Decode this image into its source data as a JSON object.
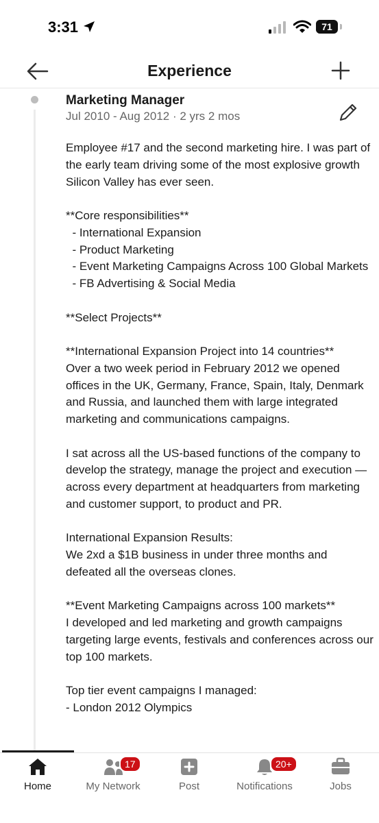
{
  "status_bar": {
    "time": "3:31",
    "battery": "71",
    "battery_level": 0.71
  },
  "header": {
    "title": "Experience"
  },
  "experience": {
    "title": "Marketing Manager",
    "dates": "Jul 2010 - Aug 2012 · 2 yrs 2 mos",
    "description": "Employee #17 and the second marketing hire. I was part of the early team driving some of the most explosive growth Silicon Valley has ever seen.\n\n**Core responsibilities**\n  - International Expansion\n  - Product Marketing\n  - Event Marketing Campaigns Across 100 Global Markets\n  - FB Advertising & Social Media\n\n**Select Projects**\n\n**International Expansion Project into 14 countries**\nOver a two week period in February 2012 we opened offices in the UK, Germany, France, Spain, Italy, Denmark and Russia, and launched them with large integrated marketing and communications campaigns.\n\nI sat across all the US-based functions of the company to develop the strategy, manage the project and execution — across every department at headquarters from marketing and customer support, to product and PR.\n\nInternational Expansion Results:\nWe 2xd a $1B business in under three months and defeated all the overseas clones.\n\n**Event Marketing Campaigns across 100 markets**\nI developed and led marketing and growth campaigns targeting large events, festivals and conferences across our top 100 markets.\n\nTop tier event campaigns I managed:\n- London 2012 Olympics"
  },
  "bottom_nav": {
    "items": [
      {
        "label": "Home",
        "icon": "home-icon",
        "active": true
      },
      {
        "label": "My Network",
        "icon": "network-icon",
        "badge": "17"
      },
      {
        "label": "Post",
        "icon": "post-icon"
      },
      {
        "label": "Notifications",
        "icon": "bell-icon",
        "badge": "20+"
      },
      {
        "label": "Jobs",
        "icon": "briefcase-icon"
      }
    ]
  },
  "colors": {
    "badge": "#cc1016",
    "text": "#1a1a1a",
    "secondary_text": "#666666"
  }
}
